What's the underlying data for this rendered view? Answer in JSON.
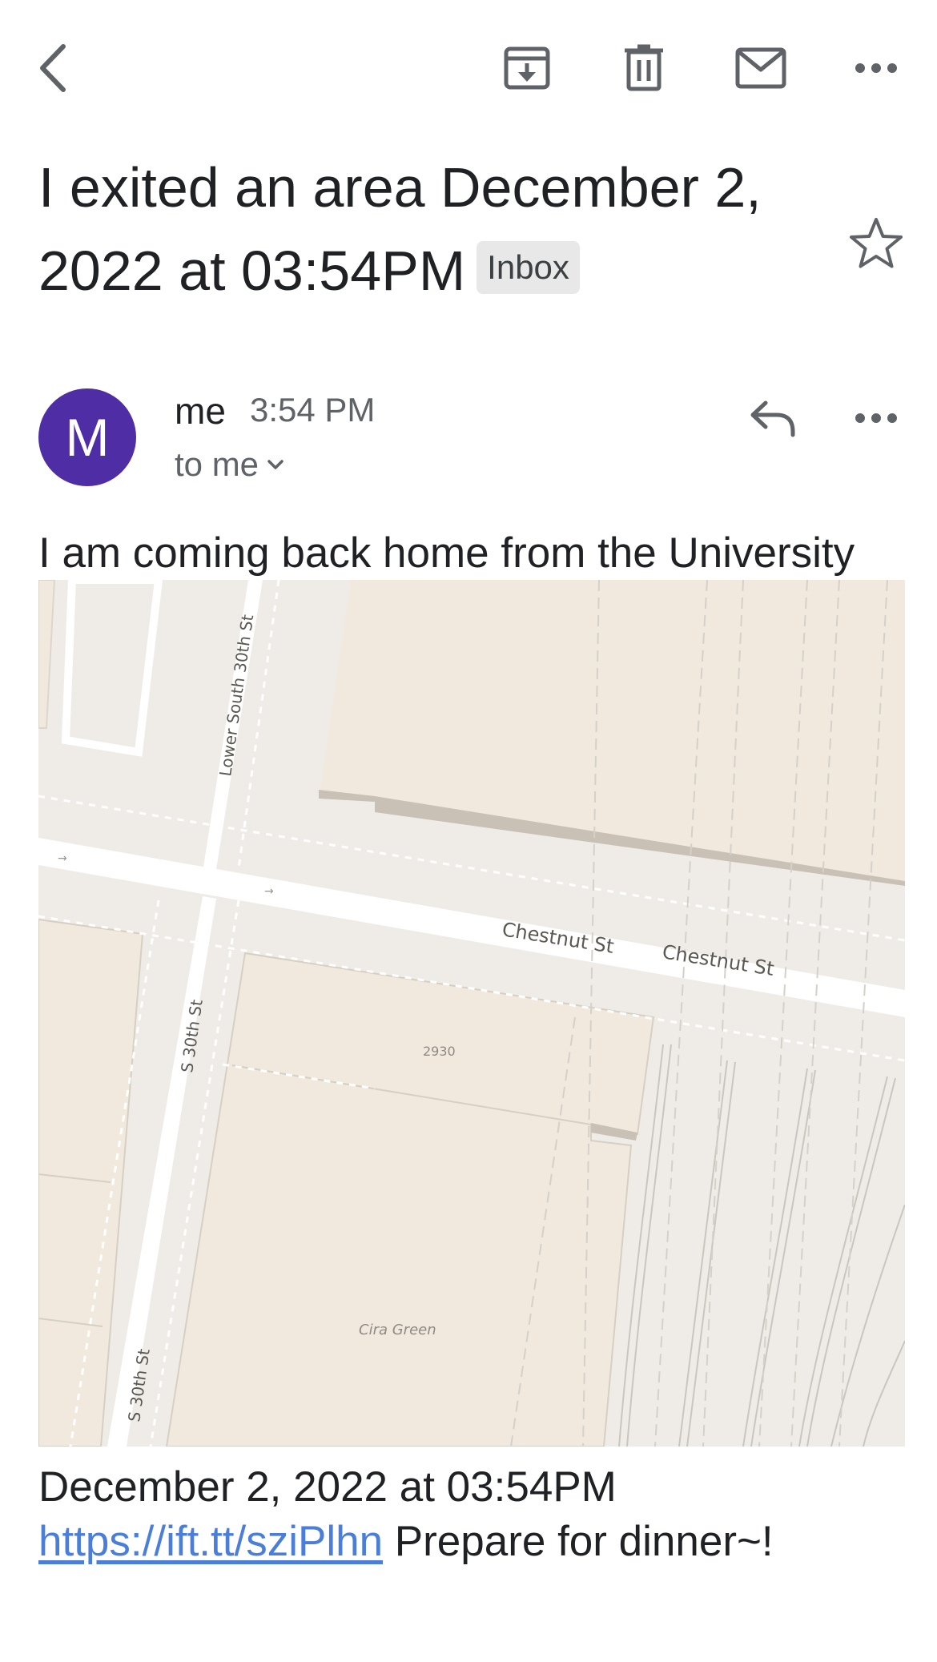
{
  "toolbar": {
    "back_icon": "chevron-left-icon",
    "archive_icon": "archive-icon",
    "delete_icon": "trash-icon",
    "mark_unread_icon": "mail-icon",
    "more_icon": "more-horizontal-icon"
  },
  "email": {
    "subject": "I exited an area December 2, 2022 at 03:54PM",
    "label": "Inbox",
    "starred": false,
    "sender": "me",
    "avatar_letter": "M",
    "avatar_color": "#4f2da5",
    "time": "3:54 PM",
    "recipient": "to me",
    "body_intro": "I am coming back home from the University",
    "map": {
      "labels": {
        "lower_south_30th": "Lower South 30th St",
        "chestnut_1": "Chestnut St",
        "chestnut_2": "Chestnut St",
        "s30th_upper": "S 30th St",
        "s30th_lower": "S 30th St",
        "address": "2930",
        "park": "Cira Green"
      }
    },
    "date_line": "December 2, 2022 at 03:54PM",
    "link_text": "https://ift.tt/sziPlhn",
    "closing": "Prepare for dinner~!",
    "link_color": "#4a7ed9"
  }
}
